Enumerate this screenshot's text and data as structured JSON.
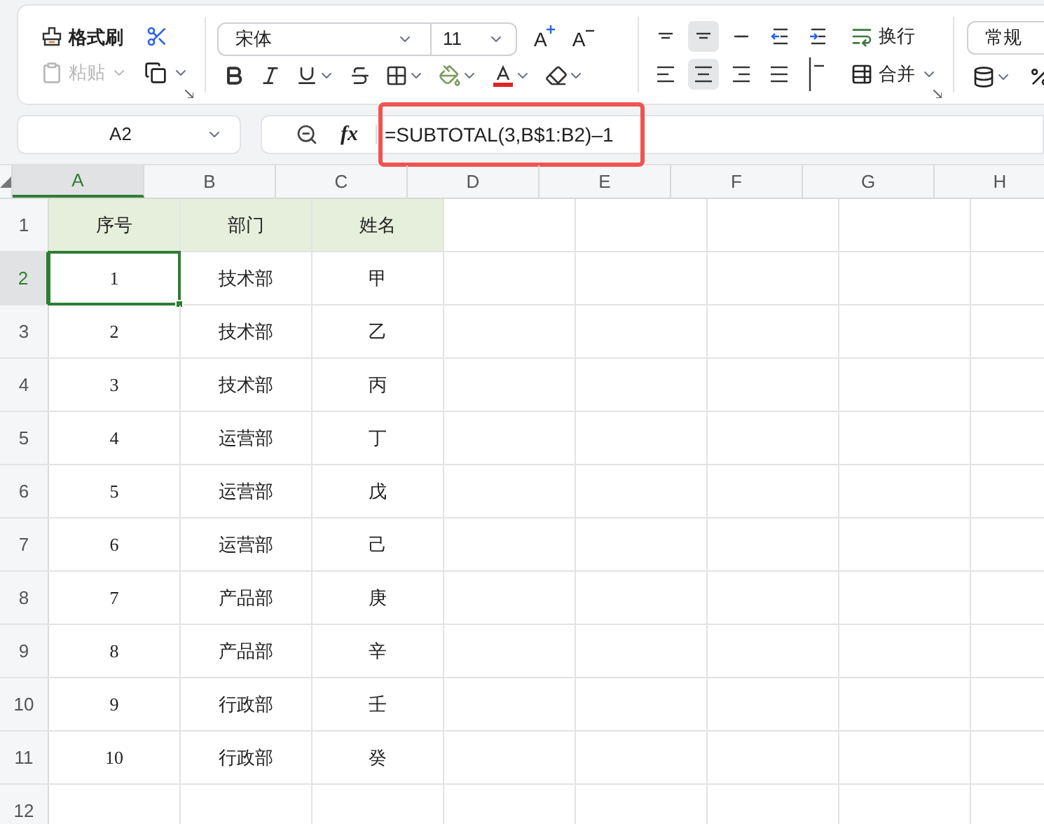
{
  "toolbar": {
    "format_painter": "格式刷",
    "paste": {
      "label": "粘贴",
      "disabled": true
    },
    "font": {
      "name": "宋体",
      "size": "11"
    },
    "grow_font": "A",
    "shrink_font": "A",
    "vertical_align": [
      {
        "kind": "top",
        "selected": false
      },
      {
        "kind": "middle",
        "selected": true
      },
      {
        "kind": "bottom",
        "selected": false
      },
      {
        "kind": "outdent",
        "selected": false
      },
      {
        "kind": "indent",
        "selected": false
      }
    ],
    "horizontal_align": [
      {
        "kind": "left",
        "selected": false
      },
      {
        "kind": "center",
        "selected": true
      },
      {
        "kind": "right",
        "selected": false
      },
      {
        "kind": "justify",
        "selected": false
      },
      {
        "kind": "distributed",
        "selected": false
      }
    ],
    "wrap": "换行",
    "merge": "合并",
    "number_format": "常规"
  },
  "formula_bar": {
    "name_box": "A2",
    "function_label": "fx",
    "formula": "=SUBTOTAL(3,B$1:B2)–1",
    "highlighted": true
  },
  "sheet": {
    "columns": [
      {
        "label": "A",
        "selected": true
      },
      {
        "label": "B",
        "selected": false
      },
      {
        "label": "C",
        "selected": false
      },
      {
        "label": "D",
        "selected": false
      },
      {
        "label": "E",
        "selected": false
      },
      {
        "label": "F",
        "selected": false
      },
      {
        "label": "G",
        "selected": false
      },
      {
        "label": "H",
        "selected": false
      }
    ],
    "rows": [
      {
        "label": "1",
        "selected": false,
        "kind": "header",
        "cells": [
          {
            "text": "序号",
            "selected": false
          },
          {
            "text": "部门",
            "selected": false
          },
          {
            "text": "姓名",
            "selected": false
          }
        ]
      },
      {
        "label": "2",
        "selected": true,
        "kind": "data",
        "cells": [
          {
            "text": "1",
            "selected": true
          },
          {
            "text": "技术部",
            "selected": false
          },
          {
            "text": "甲",
            "selected": false
          }
        ]
      },
      {
        "label": "3",
        "selected": false,
        "kind": "data",
        "cells": [
          {
            "text": "2",
            "selected": false
          },
          {
            "text": "技术部",
            "selected": false
          },
          {
            "text": "乙",
            "selected": false
          }
        ]
      },
      {
        "label": "4",
        "selected": false,
        "kind": "data",
        "cells": [
          {
            "text": "3",
            "selected": false
          },
          {
            "text": "技术部",
            "selected": false
          },
          {
            "text": "丙",
            "selected": false
          }
        ]
      },
      {
        "label": "5",
        "selected": false,
        "kind": "data",
        "cells": [
          {
            "text": "4",
            "selected": false
          },
          {
            "text": "运营部",
            "selected": false
          },
          {
            "text": "丁",
            "selected": false
          }
        ]
      },
      {
        "label": "6",
        "selected": false,
        "kind": "data",
        "cells": [
          {
            "text": "5",
            "selected": false
          },
          {
            "text": "运营部",
            "selected": false
          },
          {
            "text": "戊",
            "selected": false
          }
        ]
      },
      {
        "label": "7",
        "selected": false,
        "kind": "data",
        "cells": [
          {
            "text": "6",
            "selected": false
          },
          {
            "text": "运营部",
            "selected": false
          },
          {
            "text": "己",
            "selected": false
          }
        ]
      },
      {
        "label": "8",
        "selected": false,
        "kind": "data",
        "cells": [
          {
            "text": "7",
            "selected": false
          },
          {
            "text": "产品部",
            "selected": false
          },
          {
            "text": "庚",
            "selected": false
          }
        ]
      },
      {
        "label": "9",
        "selected": false,
        "kind": "data",
        "cells": [
          {
            "text": "8",
            "selected": false
          },
          {
            "text": "产品部",
            "selected": false
          },
          {
            "text": "辛",
            "selected": false
          }
        ]
      },
      {
        "label": "10",
        "selected": false,
        "kind": "data",
        "cells": [
          {
            "text": "9",
            "selected": false
          },
          {
            "text": "行政部",
            "selected": false
          },
          {
            "text": "壬",
            "selected": false
          }
        ]
      },
      {
        "label": "11",
        "selected": false,
        "kind": "data",
        "cells": [
          {
            "text": "10",
            "selected": false
          },
          {
            "text": "行政部",
            "selected": false
          },
          {
            "text": "癸",
            "selected": false
          }
        ]
      },
      {
        "label": "12",
        "selected": false,
        "kind": "data"
      }
    ]
  }
}
